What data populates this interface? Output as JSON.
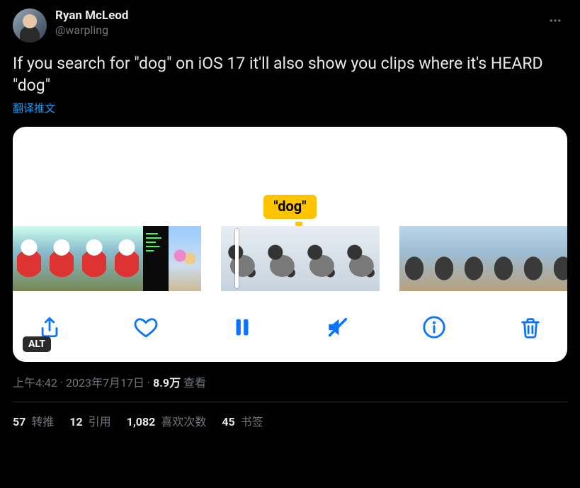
{
  "user": {
    "display_name": "Ryan McLeod",
    "handle": "@warpling"
  },
  "tweet_text": "If you search for \"dog\" on iOS 17 it'll also show you clips where it's HEARD \"dog\"",
  "translate_label": "翻译推文",
  "media": {
    "caption_bubble": "\"dog\"",
    "alt_badge": "ALT"
  },
  "meta": {
    "time": "上午4:42",
    "dot1": " · ",
    "date": "2023年7月17日",
    "dot2": " · ",
    "views_count": "8.9万",
    "views_label": " 查看"
  },
  "stats": {
    "retweets_count": "57",
    "retweets_label": " 转推",
    "quotes_count": "12",
    "quotes_label": " 引用",
    "likes_count": "1,082",
    "likes_label": " 喜欢次数",
    "bookmarks_count": "45",
    "bookmarks_label": " 书签"
  }
}
